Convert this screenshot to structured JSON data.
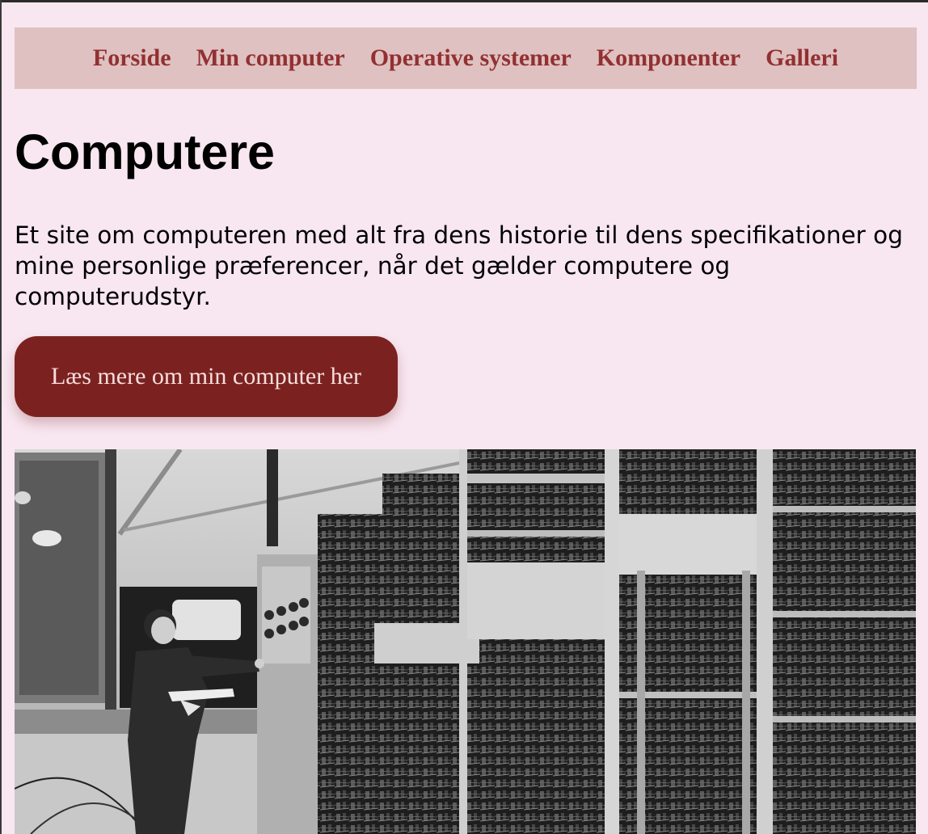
{
  "nav": {
    "items": [
      {
        "label": "Forside"
      },
      {
        "label": "Min computer"
      },
      {
        "label": "Operative systemer"
      },
      {
        "label": "Komponenter"
      },
      {
        "label": "Galleri"
      }
    ]
  },
  "hero": {
    "title": "Computere",
    "intro": "Et site om computeren med alt fra dens historie til dens specifikationer og mine personlige præferencer, når det gælder computere og computerudstyr.",
    "cta_label": "Læs mere om min computer her"
  },
  "colors": {
    "page_background": "#f8e6f0",
    "nav_background": "#dfc1c1",
    "nav_link": "#933031",
    "button_background": "#7b2220",
    "button_text": "#f7dede"
  }
}
